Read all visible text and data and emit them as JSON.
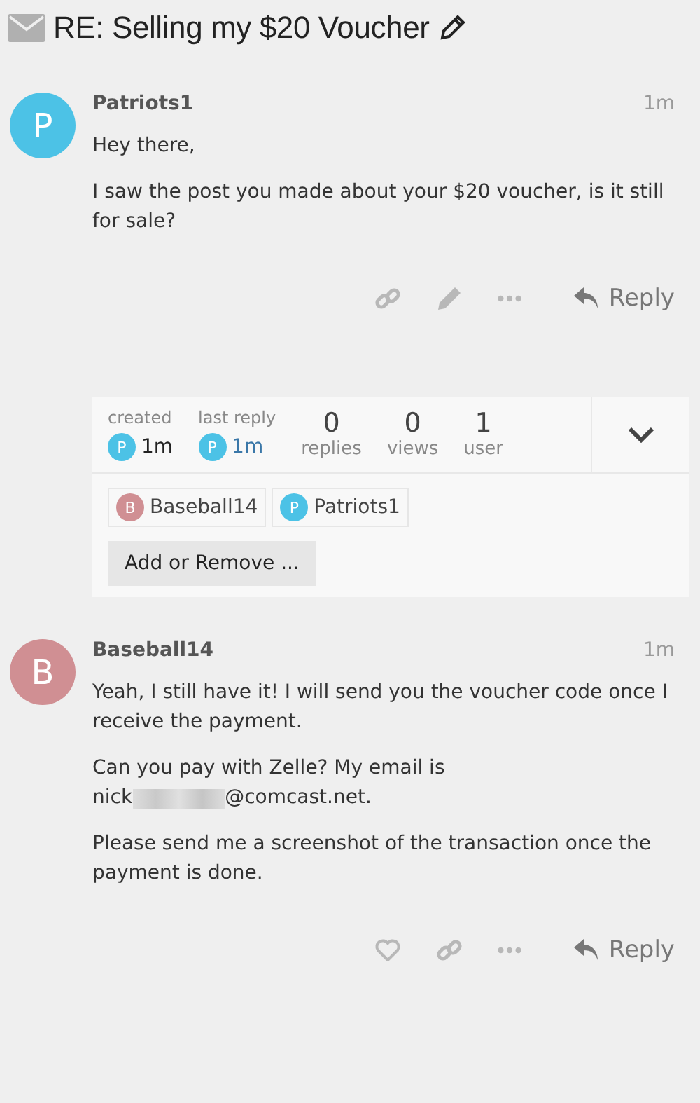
{
  "title": "RE: Selling my $20 Voucher",
  "posts": [
    {
      "author": "Patriots1",
      "initial": "P",
      "color": "#4cc2e6",
      "time": "1m",
      "paragraphs": [
        {
          "kind": "text",
          "text": "Hey there,"
        },
        {
          "kind": "text",
          "text": "I saw the post you made about your $20 voucher, is it still for sale?"
        }
      ],
      "actions": [
        {
          "kind": "link"
        },
        {
          "kind": "edit"
        },
        {
          "kind": "more"
        }
      ],
      "reply": "Reply"
    },
    {
      "author": "Baseball14",
      "initial": "B",
      "color": "#d08f93",
      "time": "1m",
      "paragraphs": [
        {
          "kind": "text",
          "text": "Yeah, I still have it! I will send you the voucher code once I receive the payment."
        },
        {
          "kind": "email",
          "text": "Can you pay with Zelle? My email is",
          "start": "nick",
          "end": "@comcast.net."
        },
        {
          "kind": "text",
          "text": "Please send me a screenshot of the transaction once the payment is done."
        }
      ],
      "actions": [
        {
          "kind": "like"
        },
        {
          "kind": "link"
        },
        {
          "kind": "more"
        }
      ],
      "reply": "Reply"
    }
  ],
  "topic_map": {
    "created": {
      "label": "created",
      "initial": "P",
      "color": "#4cc2e6",
      "time": "1m"
    },
    "last_reply": {
      "label": "last reply",
      "initial": "P",
      "color": "#4cc2e6",
      "time": "1m"
    },
    "stats": [
      {
        "value": "0",
        "label": "replies"
      },
      {
        "value": "0",
        "label": "views"
      },
      {
        "value": "1",
        "label": "user"
      }
    ],
    "participants": [
      {
        "name": "Baseball14",
        "initial": "B",
        "color": "#d08f93"
      },
      {
        "name": "Patriots1",
        "initial": "P",
        "color": "#4cc2e6"
      }
    ],
    "button": "Add or Remove ..."
  }
}
